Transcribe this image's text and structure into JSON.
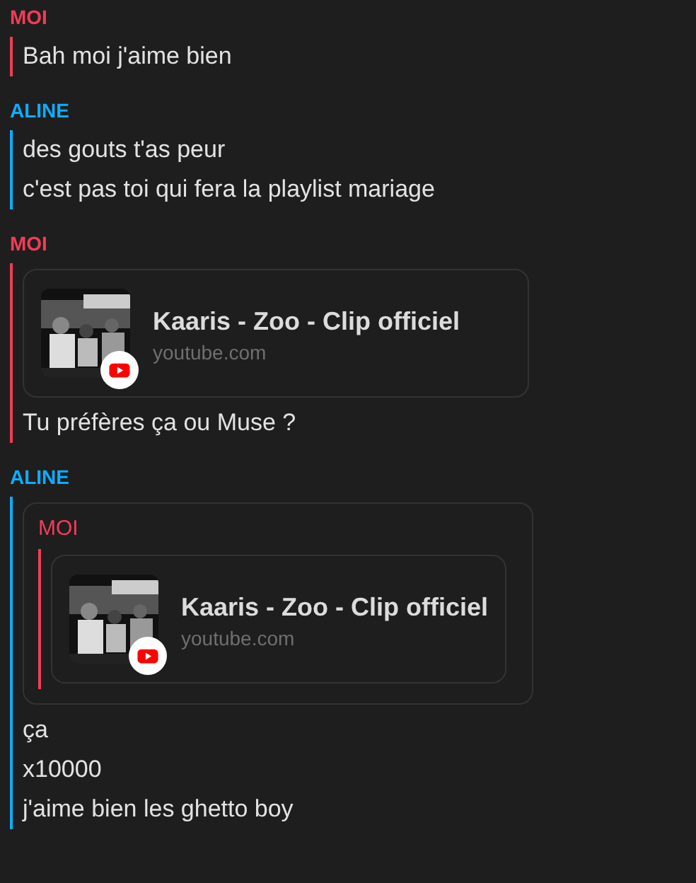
{
  "messages": [
    {
      "sender": "MOI",
      "color": "#f23c57",
      "parts": [
        {
          "kind": "text",
          "text": "Bah moi j'aime bien"
        }
      ]
    },
    {
      "sender": "ALINE",
      "color": "#0eadff",
      "parts": [
        {
          "kind": "text",
          "text": "des gouts t'as peur"
        },
        {
          "kind": "text",
          "text": "c'est pas toi qui fera la playlist mariage"
        }
      ]
    },
    {
      "sender": "MOI",
      "color": "#f23c57",
      "parts": [
        {
          "kind": "link",
          "title": "Kaaris - Zoo - Clip officiel",
          "domain": "youtube.com"
        },
        {
          "kind": "text",
          "text": "Tu préfères ça ou Muse ?"
        }
      ]
    },
    {
      "sender": "ALINE",
      "color": "#0eadff",
      "parts": [
        {
          "kind": "quote",
          "sender": "MOI",
          "color": "#f23c57",
          "parts": [
            {
              "kind": "link",
              "title": "Kaaris - Zoo - Clip officiel",
              "domain": "youtube.com"
            }
          ]
        },
        {
          "kind": "text",
          "text": "ça"
        },
        {
          "kind": "text",
          "text": "x10000"
        },
        {
          "kind": "text",
          "text": "j'aime bien les ghetto boy"
        }
      ]
    }
  ]
}
